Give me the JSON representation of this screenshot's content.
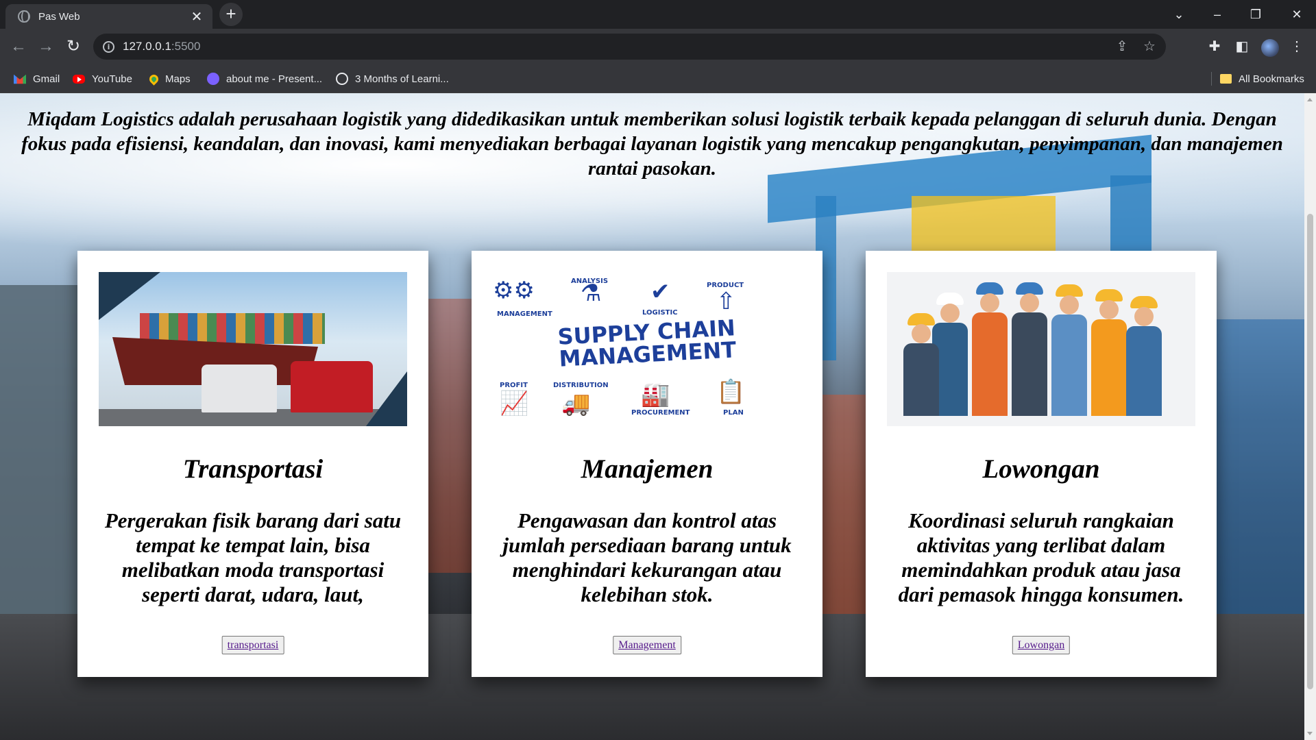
{
  "browser": {
    "tab_title": "Pas Web",
    "url_host": "127.0.0.1",
    "url_port": ":5500",
    "bookmarks": [
      {
        "label": "Gmail",
        "icon": "gmail-icon"
      },
      {
        "label": "YouTube",
        "icon": "youtube-icon"
      },
      {
        "label": "Maps",
        "icon": "maps-icon"
      },
      {
        "label": "about me - Present...",
        "icon": "presentation-icon"
      },
      {
        "label": "3 Months of Learni...",
        "icon": "globe-icon"
      }
    ],
    "all_bookmarks": "All Bookmarks"
  },
  "page": {
    "intro": "Miqdam Logistics adalah perusahaan logistik yang didedikasikan untuk memberikan solusi logistik terbaik kepada pelanggan di seluruh dunia. Dengan fokus pada efisiensi, keandalan, dan inovasi, kami menyediakan berbagai layanan logistik yang mencakup pengangkutan, penyimpanan, dan manajemen rantai pasokan.",
    "cards": [
      {
        "title": "Transportasi",
        "description": "Pergerakan fisik barang dari satu tempat ke tempat lain, bisa melibatkan moda transportasi seperti darat, udara, laut,",
        "button": "transportasi"
      },
      {
        "title": "Manajemen",
        "description": "Pengawasan dan kontrol atas jumlah persediaan barang untuk menghindari kekurangan atau kelebihan stok.",
        "button": "Management",
        "image_text": {
          "headline_1": "SUPPLY CHAIN",
          "headline_2": "MANAGEMENT",
          "labels": [
            "MANAGEMENT",
            "ANALYSIS",
            "LOGISTIC",
            "PRODUCT",
            "PROFIT",
            "DISTRIBUTION",
            "PROCUREMENT",
            "PLAN"
          ]
        }
      },
      {
        "title": "Lowongan",
        "description": "Koordinasi seluruh rangkaian aktivitas yang terlibat dalam memindahkan produk atau jasa dari pemasok hingga konsumen.",
        "button": "Lowongan"
      }
    ]
  },
  "colors": {
    "chrome_dark": "#202124",
    "chrome_toolbar": "#35363a",
    "link_visited": "#551a8b",
    "scm_blue": "#1d3f9a"
  }
}
